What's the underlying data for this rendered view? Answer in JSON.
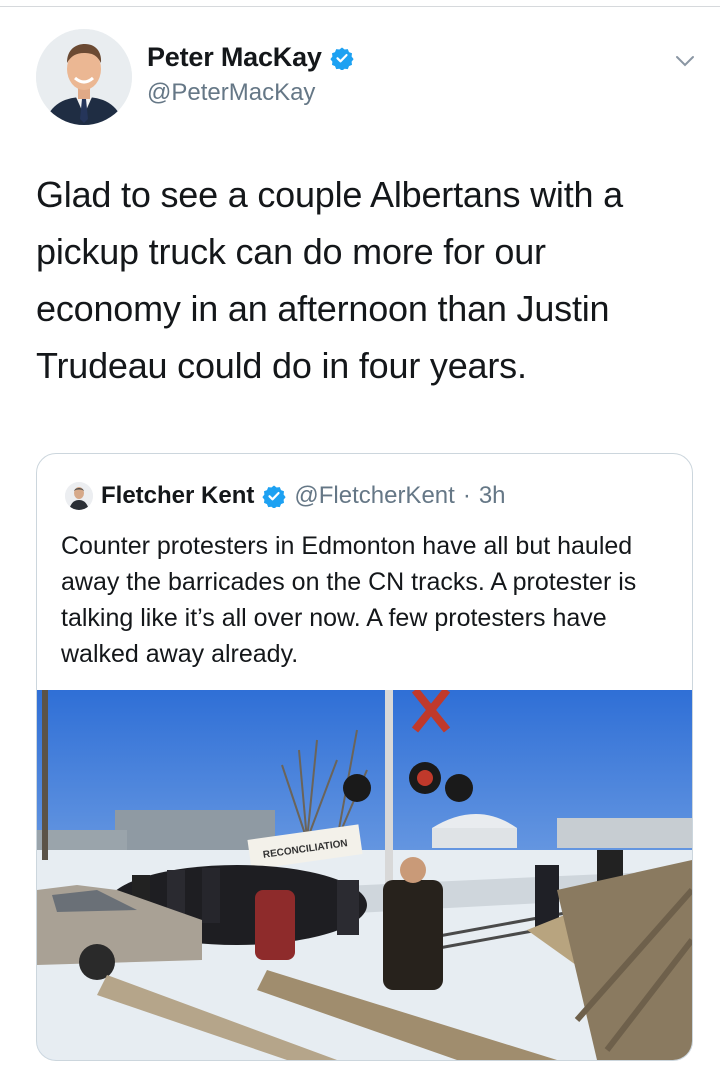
{
  "tweet": {
    "author_name": "Peter MacKay",
    "author_handle": "@PeterMacKay",
    "text": "Glad to see a couple Albertans with a pickup truck can do more for our economy in an afternoon than Justin Trudeau could do in four years.",
    "verified": true
  },
  "quote": {
    "author_name": "Fletcher Kent",
    "author_handle": "@FletcherKent",
    "separator": "·",
    "time": "3h",
    "verified": true,
    "text": "Counter protesters in Edmonton have all but hauled away the barricades on the CN tracks. A protester is talking like it’s all over now. A few protesters have walked away already.",
    "photo_sign_text": "RECONCILIATION"
  },
  "icons": {
    "verified": "verified-badge-icon",
    "menu": "chevron-down-icon"
  },
  "colors": {
    "verified_blue": "#1da1f2",
    "secondary_text": "#657786"
  }
}
